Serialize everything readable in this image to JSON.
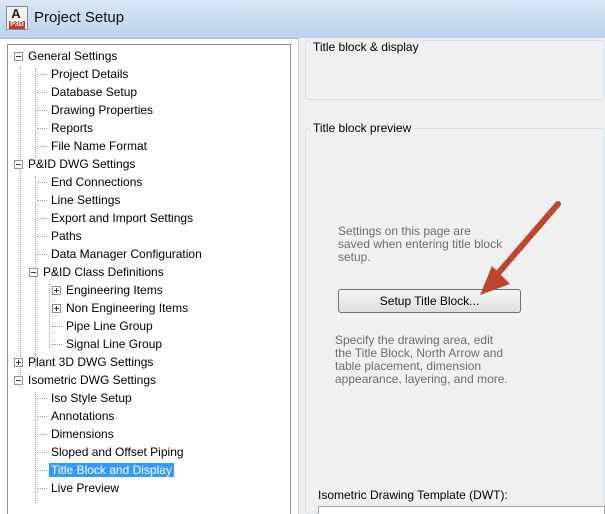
{
  "window": {
    "title": "Project Setup",
    "icon": "autocad-p3d-app-icon",
    "icon_letter": "A",
    "icon_badge": "P3D"
  },
  "tree": [
    {
      "label": "General Settings",
      "expander": "minus"
    },
    {
      "label": "Project Details"
    },
    {
      "label": "Database Setup"
    },
    {
      "label": "Drawing Properties"
    },
    {
      "label": "Reports"
    },
    {
      "label": "File Name Format"
    },
    {
      "label": "P&ID DWG Settings",
      "expander": "minus"
    },
    {
      "label": "End Connections"
    },
    {
      "label": "Line Settings"
    },
    {
      "label": "Export and Import Settings"
    },
    {
      "label": "Paths"
    },
    {
      "label": "Data Manager Configuration"
    },
    {
      "label": "P&ID Class Definitions",
      "expander": "minus"
    },
    {
      "label": "Engineering Items",
      "expander": "plus"
    },
    {
      "label": "Non Engineering Items",
      "expander": "plus"
    },
    {
      "label": "Pipe Line Group"
    },
    {
      "label": "Signal Line Group"
    },
    {
      "label": "Plant 3D DWG Settings",
      "expander": "plus"
    },
    {
      "label": "Isometric DWG Settings",
      "expander": "minus"
    },
    {
      "label": "Iso Style Setup"
    },
    {
      "label": "Annotations"
    },
    {
      "label": "Dimensions"
    },
    {
      "label": "Sloped and Offset Piping"
    },
    {
      "label": "Title Block and Display",
      "selected": true
    },
    {
      "label": "Live Preview"
    }
  ],
  "panel": {
    "group_title": "Title block & display",
    "preview_title": "Title block preview",
    "info_lines": [
      "Settings on this page are",
      "saved when entering title block",
      "setup."
    ],
    "button_label": "Setup Title Block...",
    "desc_lines": [
      "Specify the drawing area, edit",
      "the Title Block, North Arrow and",
      "table placement, dimension",
      "appearance, layering, and more."
    ],
    "template_label": "Isometric Drawing Template (DWT):"
  },
  "colors": {
    "selection": "#3399ff",
    "arrow": "#c0452e",
    "titlebar": "#c9dcf1"
  }
}
